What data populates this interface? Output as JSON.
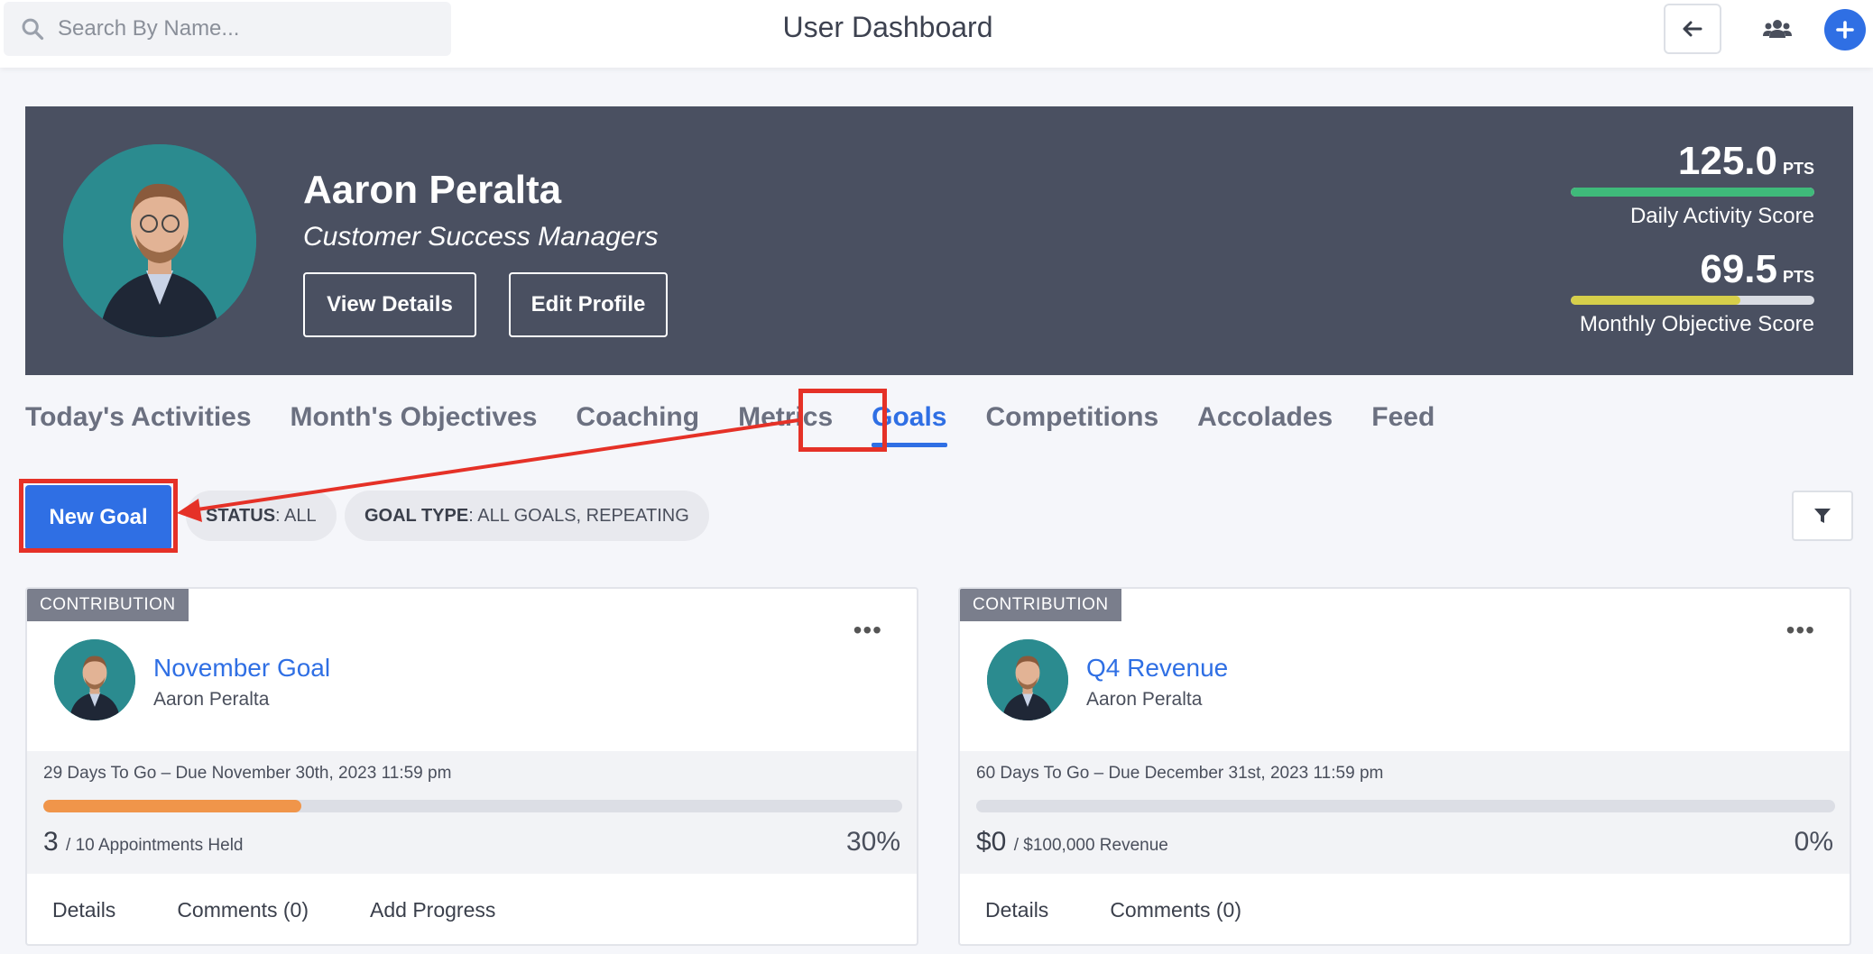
{
  "search": {
    "placeholder": "Search By Name..."
  },
  "header": {
    "title": "User Dashboard"
  },
  "icons": {
    "search": "search-icon",
    "back": "arrow-left-icon",
    "team": "users-icon",
    "add": "plus-icon",
    "filter": "filter-icon",
    "menu": "more-horizontal-icon"
  },
  "colors": {
    "accent": "#2f6fe4",
    "hero_bg": "#4a5061",
    "daily_bar": "#3fba7a",
    "monthly_bar": "#d6cf4a",
    "progress": "#f0954a",
    "annotation": "#e53127"
  },
  "profile": {
    "name": "Aaron Peralta",
    "role": "Customer Success Managers",
    "view_details": "View Details",
    "edit_profile": "Edit Profile"
  },
  "scores": [
    {
      "value": "125.0",
      "unit": "PTS",
      "label": "Daily Activity Score",
      "fill_percent": 100
    },
    {
      "value": "69.5",
      "unit": "PTS",
      "label": "Monthly Objective Score",
      "fill_percent": 69.5
    }
  ],
  "tabs": [
    {
      "label": "Today's Activities"
    },
    {
      "label": "Month's Objectives"
    },
    {
      "label": "Coaching"
    },
    {
      "label": "Metrics"
    },
    {
      "label": "Goals",
      "active": true
    },
    {
      "label": "Competitions"
    },
    {
      "label": "Accolades"
    },
    {
      "label": "Feed"
    }
  ],
  "toolbar": {
    "new_goal": "New Goal",
    "status_key": "STATUS",
    "status_value": ": ALL",
    "type_key": "GOAL TYPE",
    "type_value": ": ALL GOALS, REPEATING"
  },
  "goals": [
    {
      "ribbon": "CONTRIBUTION",
      "title": "November Goal",
      "owner": "Aaron Peralta",
      "due": "29 Days To Go – Due November 30th, 2023 11:59 pm",
      "current": "3",
      "target": "/ 10 Appointments Held",
      "percent": "30%",
      "progress_percent": 30,
      "actions": [
        "Details",
        "Comments (0)",
        "Add Progress"
      ]
    },
    {
      "ribbon": "CONTRIBUTION",
      "title": "Q4 Revenue",
      "owner": "Aaron Peralta",
      "due": "60 Days To Go – Due December 31st, 2023 11:59 pm",
      "current": "$0",
      "target": "/ $100,000 Revenue",
      "percent": "0%",
      "progress_percent": 0,
      "actions": [
        "Details",
        "Comments (0)"
      ]
    }
  ]
}
